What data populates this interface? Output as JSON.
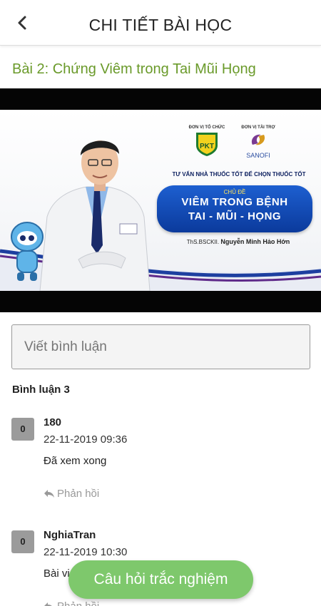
{
  "header": {
    "title": "CHI TIẾT BÀI HỌC",
    "back_icon": "chevron-left-icon"
  },
  "lesson": {
    "title": "Bài 2: Chứng Viêm trong Tai Mũi Họng"
  },
  "video": {
    "organizer_caption": "ĐƠN VỊ TỔ CHỨC",
    "organizer_logo": "PKT",
    "sponsor_caption": "ĐƠN VỊ TÀI TRỢ",
    "sponsor_name": "SANOFI",
    "tagline": "TƯ VẤN NHÀ THUỐC TỐT ĐỂ CHỌN THUỐC TỐT",
    "topic_label": "CHỦ ĐỀ",
    "topic_line1": "VIÊM TRONG BỆNH",
    "topic_line2": "TAI - MŨI - HỌNG",
    "presenter_title": "ThS.BSCKII.",
    "presenter_name": "Nguyễn Minh Hảo Hớn"
  },
  "comment_input": {
    "placeholder": "Viết bình luận"
  },
  "comments_header": "Bình luận 3",
  "comments": [
    {
      "badge": "0",
      "author": "180",
      "time": "22-11-2019 09:36",
      "body": "Đã xem xong",
      "reply_label": "Phản hồi"
    },
    {
      "badge": "0",
      "author": "NghiaTran",
      "time": "22-11-2019 10:30",
      "body": "Bài vi",
      "reply_label": "Phản hồi"
    }
  ],
  "quiz_button": {
    "label": "Câu hỏi trắc nghiệm"
  },
  "colors": {
    "accent_green": "#6a9a2a",
    "quiz_button": "#7ec86c",
    "badge_gray": "#9b9b9b",
    "topic_blue": "#1d5fd0"
  }
}
